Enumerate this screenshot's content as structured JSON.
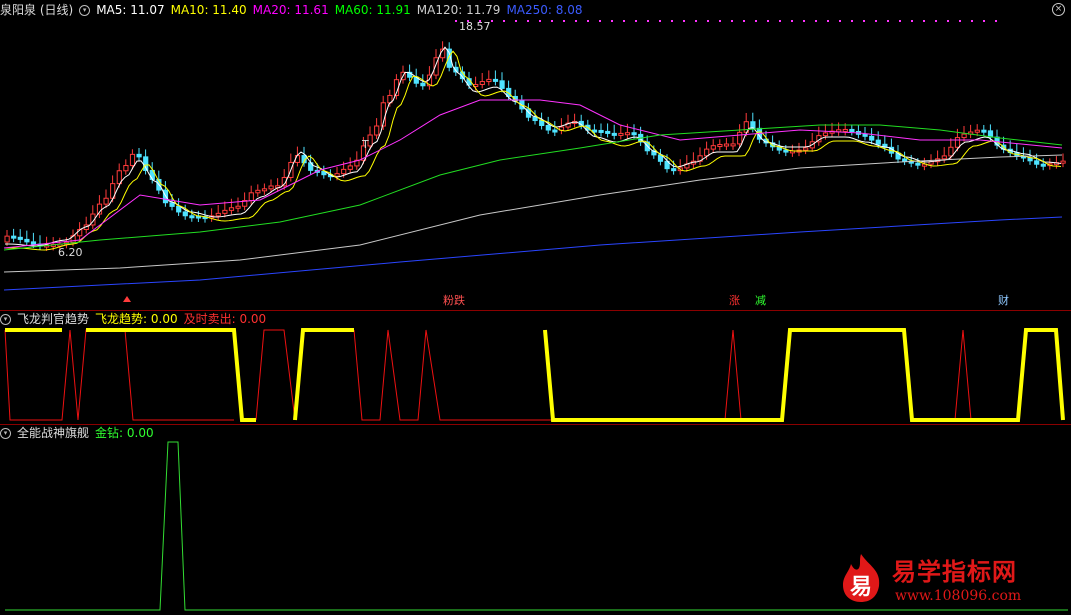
{
  "main_panel": {
    "title": "泉阳泉 (日线)",
    "indicators": [
      {
        "label": "MA5: 11.07",
        "color": "#ffffff"
      },
      {
        "label": "MA10: 11.40",
        "color": "#ffff00"
      },
      {
        "label": "MA20: 11.61",
        "color": "#ff00ff"
      },
      {
        "label": "MA60: 11.91",
        "color": "#00ff00"
      },
      {
        "label": "MA120: 11.79",
        "color": "#c0c0c0"
      },
      {
        "label": "MA250: 8.08",
        "color": "#3b5bff"
      }
    ],
    "high_label": "18.57",
    "low_label": "6.20",
    "t_mark": "T",
    "signals": [
      {
        "text": "粉跌",
        "color": "#ff3030",
        "bg": "#3a2a00"
      },
      {
        "text": "涨",
        "color": "#ff3030",
        "bg": "#3a0000"
      },
      {
        "text": "减",
        "color": "#30ff30",
        "bg": "#002a00"
      },
      {
        "text": "财",
        "color": "#8fc8ff",
        "bg": "#00224a"
      }
    ]
  },
  "panel2": {
    "title": "飞龙判官趋势",
    "value_label": "飞龙趋势: 0.00",
    "value2_label": "及时卖出: 0.00"
  },
  "panel3": {
    "title": "全能战神旗舰",
    "value_label": "金钻: 0.00"
  },
  "watermark": {
    "logo_char": "易",
    "brand": "易学指标网",
    "url": "www.108096.com"
  },
  "close_icon": "×",
  "chart_data": [
    {
      "type": "candlestick",
      "title": "泉阳泉 (日线)",
      "series": [
        {
          "name": "MA5",
          "last": 11.07
        },
        {
          "name": "MA10",
          "last": 11.4
        },
        {
          "name": "MA20",
          "last": 11.61
        },
        {
          "name": "MA60",
          "last": 11.91
        },
        {
          "name": "MA120",
          "last": 11.79
        },
        {
          "name": "MA250",
          "last": 8.08
        }
      ],
      "annotations": [
        "18.57",
        "6.20"
      ]
    },
    {
      "type": "line",
      "title": "飞龙判官趋势",
      "series": [
        {
          "name": "飞龙趋势",
          "last": 0.0
        },
        {
          "name": "及时卖出",
          "last": 0.0
        }
      ]
    },
    {
      "type": "line",
      "title": "全能战神旗舰",
      "series": [
        {
          "name": "金钻",
          "last": 0.0
        }
      ]
    }
  ]
}
